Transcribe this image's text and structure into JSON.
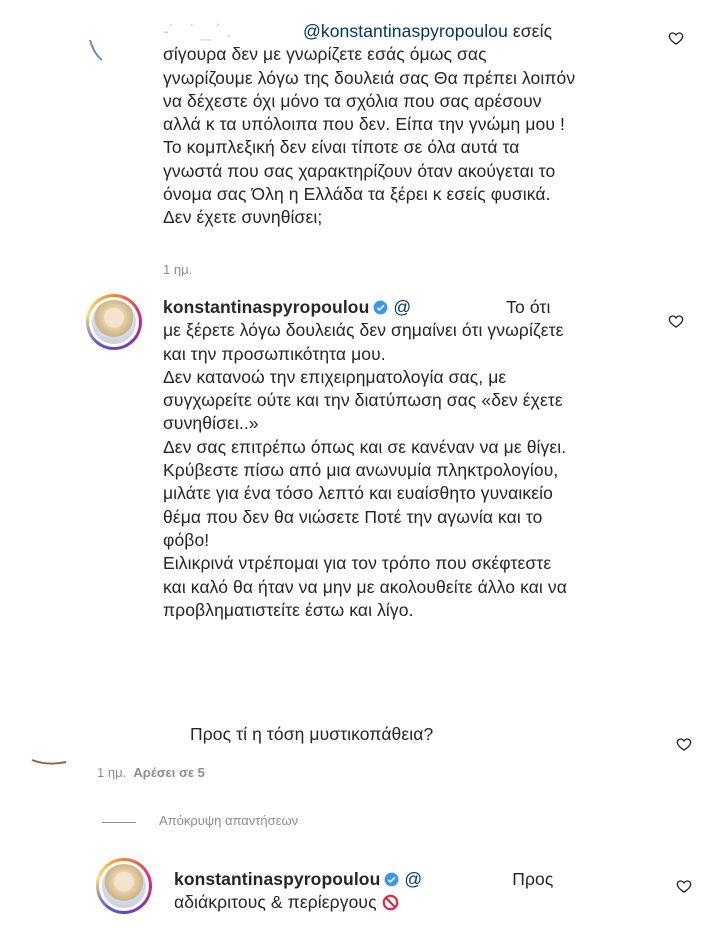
{
  "comments": [
    {
      "mention": "@konstantinaspyropoulou",
      "text_first": " εσείς",
      "text_rest": "σίγουρα δεν με γνωρίζετε εσάς όμως σας\nγνωρίζουμε λόγω της δουλειά σας Θα πρέπει λοιπόν\nνα δέχεστε όχι μόνο τα σχόλια που σας αρέσουν\nαλλά κ τα υπόλοιπα που δεν. Είπα την γνώμη μου !\nΤο κομπλεξική δεν είναι τίποτε σε όλα αυτά τα\nγνωστά που σας χαρακτηρίζουν όταν ακούγεται το\nόνομα σας Όλη η Ελλάδα τα ξέρει κ εσείς φυσικά.\nΔεν έχετε συνηθίσει;",
      "time": "1 ημ."
    },
    {
      "username": "konstantinaspyropoulou",
      "mention": "@",
      "text_first": " Το ότι",
      "text_rest": "με ξέρετε λόγω δουλειάς δεν σημαίνει ότι γνωρίζετε\nκαι την προσωπικότητα μου.\nΔεν κατανοώ την επιχειρηματολογία σας, με\nσυγχωρείτε ούτε και την διατύπωση σας «δεν έχετε\nσυνηθίσει..»\nΔεν σας επιτρέπω όπως και σε κανέναν να με θίγει.\nΚρύβεστε πίσω από μια ανωνυμία πληκτρολογίου,\nμιλάτε για ένα τόσο λεπτό και ευαίσθητο γυναικείο\nθέμα που δεν θα νιώσετε Ποτέ την αγωνία και το\nφόβο!\nΕιλικρινά ντρέπομαι για τον τρόπο που σκέφτεστε\nκαι καλό θα ήταν να μην με ακολουθείτε άλλο και να\nπροβληματιστείτε έστω και λίγο."
    },
    {
      "text": "Προς τί η τόση μυστικοπάθεια?",
      "time": "1 ημ.",
      "likes": "Αρέσει σε 5"
    }
  ],
  "hide_replies": "Απόκρυψη απαντήσεων",
  "reply": {
    "username": "konstantinaspyropoulou",
    "mention": "@",
    "text_first": "Προς",
    "text_second": "αδιάκριτους & περίεργους"
  },
  "icons": {
    "heart": "heart-icon",
    "verified": "verified-badge-icon",
    "prohibited": "prohibited-emoji-icon"
  },
  "colors": {
    "text": "#262626",
    "meta": "#8e8e8e",
    "mention": "#00376b",
    "verified": "#3897f0"
  }
}
